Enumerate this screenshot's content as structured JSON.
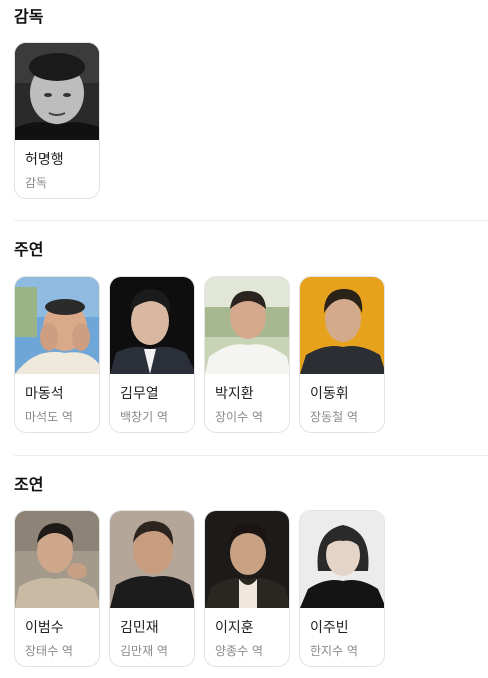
{
  "director": {
    "title": "감독",
    "people": [
      {
        "name": "허명행",
        "role": "감독"
      }
    ]
  },
  "lead": {
    "title": "주연",
    "people": [
      {
        "name": "마동석",
        "role": "마석도 역"
      },
      {
        "name": "김무열",
        "role": "백창기 역"
      },
      {
        "name": "박지환",
        "role": "장이수 역"
      },
      {
        "name": "이동휘",
        "role": "장동철 역"
      }
    ]
  },
  "supporting": {
    "title": "조연",
    "people": [
      {
        "name": "이범수",
        "role": "장태수 역"
      },
      {
        "name": "김민재",
        "role": "김만재 역"
      },
      {
        "name": "이지훈",
        "role": "양종수 역"
      },
      {
        "name": "이주빈",
        "role": "한지수 역"
      }
    ]
  }
}
